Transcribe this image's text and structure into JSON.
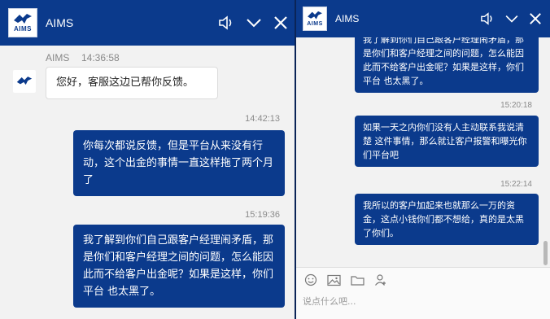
{
  "left": {
    "app_title": "AIMS",
    "logo_text": "AIMS",
    "sender_name": "AIMS",
    "sender_time": "14:36:58",
    "incoming": "您好，客服这边已帮你反馈。",
    "outgoing": [
      {
        "time": "14:42:13",
        "text": "你每次都说反馈，但是平台从来没有行动，这个出金的事情一直这样拖了两个月了"
      },
      {
        "time": "15:19:36",
        "text": "我了解到你们自己跟客户经理闹矛盾，那是你们和客户经理之间的问题，怎么能因此而不给客户出金呢？如果是这样，你们平台 也太黑了。"
      }
    ]
  },
  "right": {
    "app_title": "AIMS",
    "logo_text": "AIMS",
    "outgoing": [
      {
        "time": "",
        "text": "我了解到你们自己跟客户经理闹矛盾，那是你们和客户经理之间的问题，怎么能因此而不给客户出金呢？如果是这样，你们平台 也太黑了。"
      },
      {
        "time": "15:20:18",
        "text": "如果一天之内你们没有人主动联系我说清楚 这件事情，那么就让客户报警和曝光你们平台吧"
      },
      {
        "time": "15:22:14",
        "text": "我所以的客户加起来也就那么一万的资金，这点小钱你们都不想给，真的是太黑了你们。"
      }
    ],
    "input_placeholder": "说点什么吧..."
  },
  "colors": {
    "brand": "#0b3a8c",
    "window_bg": "#f2f2f2"
  },
  "icons": [
    "speaker-icon",
    "chevron-down-icon",
    "close-icon",
    "emoji-icon",
    "image-icon",
    "folder-icon",
    "user-icon"
  ]
}
